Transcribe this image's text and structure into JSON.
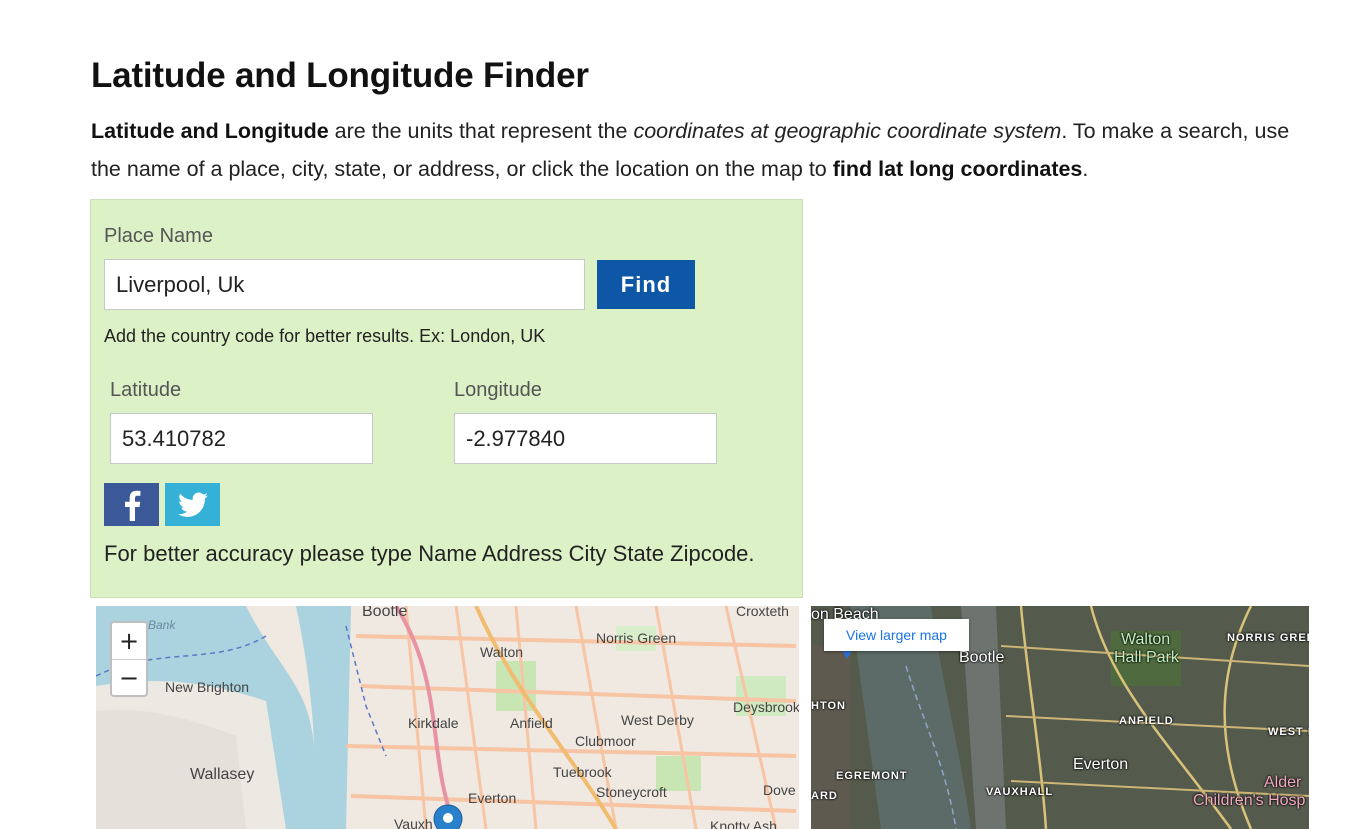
{
  "title": "Latitude and Longitude Finder",
  "intro": {
    "bold_lead": "Latitude and Longitude",
    "text1": " are the units that represent the ",
    "italic": "coordinates at geographic coordinate system",
    "text2": ". To make a search, use the name of a place, city, state, or address, or click the location on the map to ",
    "bold_tail": "find lat long coordinates",
    "end": "."
  },
  "form": {
    "place_label": "Place Name",
    "place_value": "Liverpool, Uk",
    "find_label": "Find",
    "hint": "Add the country code for better results. Ex: London, UK",
    "lat_label": "Latitude",
    "lat_value": "53.410782",
    "lon_label": "Longitude",
    "lon_value": "-2.977840",
    "facebook_icon": "facebook-icon",
    "twitter_icon": "twitter-icon",
    "accuracy_note": "For better accuracy please type Name Address City State Zipcode."
  },
  "colors": {
    "panel_bg": "#dcf2c6",
    "find_button": "#0d57a6",
    "facebook": "#3b5998",
    "twitter": "#35b0d6"
  },
  "left_map": {
    "zoom_in": "+",
    "zoom_out": "−",
    "labels": [
      "Bootle",
      "Croxteth",
      "Norris Green",
      "Walton",
      "New Brighton",
      "Kirkdale",
      "Anfield",
      "West Derby",
      "Deysbrook",
      "Clubmoor",
      "Wallasey",
      "Tuebrook",
      "Stoneycroft",
      "Everton",
      "Dove",
      "Vauxh",
      "Knotty Ash",
      "Bank"
    ]
  },
  "right_map": {
    "larger_map_link": "View larger map",
    "labels": [
      "on Beach",
      "Bootle",
      "Walton",
      "Hall Park",
      "NORRIS GREE",
      "HTON",
      "ANFIELD",
      "WEST I",
      "EGREMONT",
      "Everton",
      "ARD",
      "VAUXHALL",
      "Alder",
      "Children's Hosp"
    ]
  }
}
